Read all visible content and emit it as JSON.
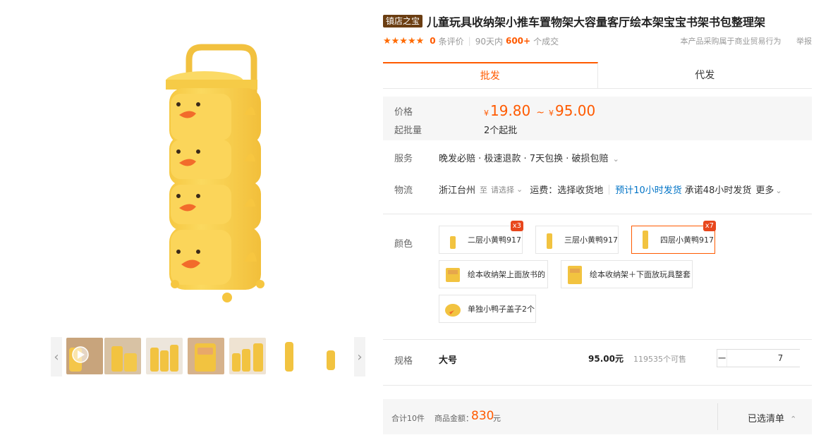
{
  "product": {
    "store_badge": "镇店之宝",
    "title": "儿童玩具收纳架小推车置物架大容量客厅绘本架宝宝书架书包整理架"
  },
  "rating": {
    "stars": "★★★★★",
    "review_count": "0",
    "review_label": "条评价",
    "sales_period": "90天内",
    "sales_count": "600+",
    "sales_label": "个成交",
    "notice": "本产品采购属于商业贸易行为",
    "report": "举报"
  },
  "tabs": [
    {
      "label": "批发",
      "active": true
    },
    {
      "label": "代发",
      "active": false
    }
  ],
  "price": {
    "label": "价格",
    "currency": "¥",
    "min": "19.80",
    "tilde": "~",
    "max": "95.00",
    "moq_label": "起批量",
    "moq_value": "2个起批"
  },
  "service": {
    "label": "服务",
    "value": "晚发必赔 · 极速退款 · 7天包换 · 破损包赔",
    "chevron": "⌄"
  },
  "logistics": {
    "label": "物流",
    "origin": "浙江台州",
    "to": "至",
    "dest_placeholder": "请选择",
    "chevron": "⌄",
    "fee": "运费：选择收货地",
    "eta": "预计10小时发货",
    "promise": "承诺48小时发货",
    "more": "更多"
  },
  "color": {
    "label": "颜色",
    "options": [
      {
        "label": "二层小黄鸭917",
        "badge": "x3",
        "selected": false
      },
      {
        "label": "三层小黄鸭917",
        "badge": "",
        "selected": false
      },
      {
        "label": "四层小黄鸭917",
        "badge": "x7",
        "selected": true
      },
      {
        "label": "绘本收纳架上面放书的",
        "badge": "",
        "selected": false
      },
      {
        "label": "绘本收纳架＋下面放玩具整套",
        "badge": "",
        "selected": false
      },
      {
        "label": "单独小鸭子盖子2个",
        "badge": "",
        "selected": false
      }
    ]
  },
  "spec": {
    "label": "规格",
    "name": "大号",
    "price": "95.00元",
    "stock": "119535个可售",
    "minus": "−",
    "quantity": "7",
    "plus": "+"
  },
  "footer": {
    "total_count": "合计10件",
    "amount_label": "商品金额：",
    "amount": "830",
    "amount_unit": "元",
    "selected_list": "已选清单",
    "selected_list_icon": "⌃"
  },
  "gallery": {
    "prev": "‹",
    "next": "›"
  },
  "colors": {
    "accent": "#ff5a00",
    "duck_yellow": "#f9d24f",
    "beak_orange": "#f26b2b",
    "badge_brown": "#6b3e12",
    "link_blue": "#0073c6"
  }
}
